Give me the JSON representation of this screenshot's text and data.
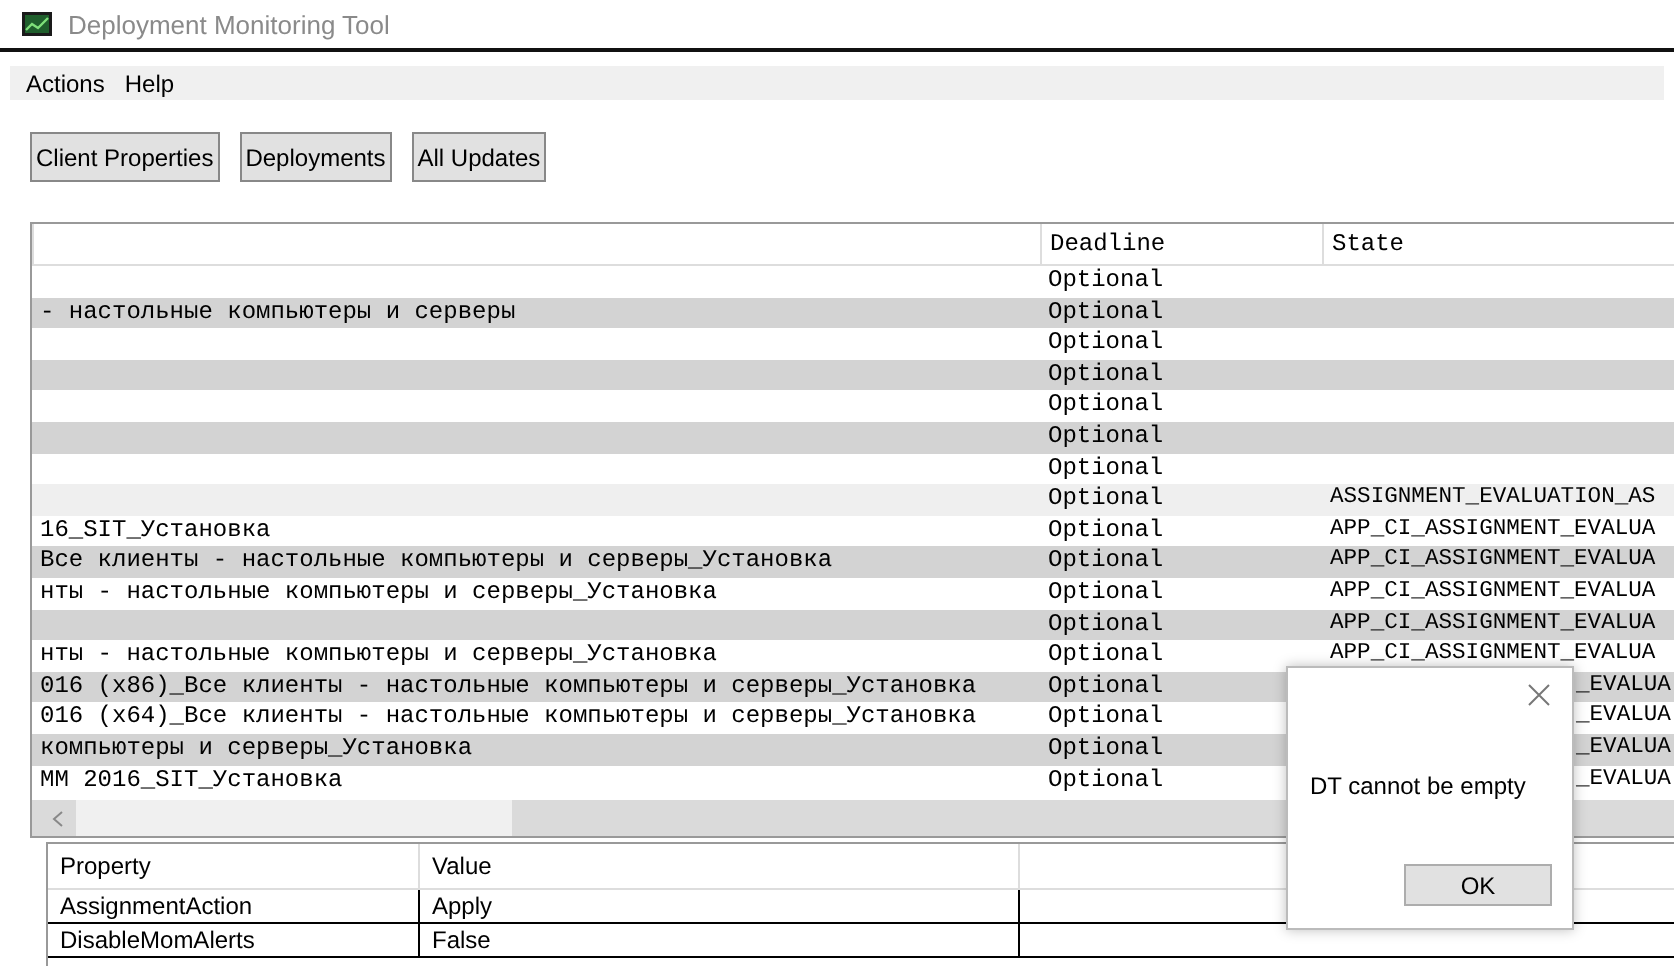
{
  "window": {
    "title": "Deployment Monitoring Tool"
  },
  "menu": [
    "Actions",
    "Help"
  ],
  "buttons": [
    "Client Properties",
    "Deployments",
    "All Updates"
  ],
  "table": {
    "columns": [
      "Deadline",
      "State"
    ],
    "rows": [
      {
        "deadline": "Optional",
        "selected": false
      },
      {
        "name": "- настольные компьютеры и серверы",
        "deadline": "Optional",
        "selected": false
      },
      {
        "deadline": "Optional",
        "selected": false
      },
      {
        "deadline": "Optional",
        "selected": false
      },
      {
        "deadline": "Optional",
        "selected": false
      },
      {
        "deadline": "Optional",
        "selected": false
      },
      {
        "deadline": "Optional",
        "selected": false
      },
      {
        "deadline": "Optional",
        "state": "ASSIGNMENT_EVALUATION_AS",
        "selected": true
      },
      {
        "name": "16_SIT_Установка",
        "deadline": "Optional",
        "state": "APP_CI_ASSIGNMENT_EVALUA",
        "selected": false
      },
      {
        "name": "Все клиенты - настольные компьютеры и серверы_Установка",
        "deadline": "Optional",
        "state": "APP_CI_ASSIGNMENT_EVALUA",
        "selected": false
      },
      {
        "name": "нты - настольные компьютеры и серверы_Установка",
        "deadline": "Optional",
        "state": "APP_CI_ASSIGNMENT_EVALUA",
        "selected": false
      },
      {
        "deadline": "Optional",
        "state": "APP_CI_ASSIGNMENT_EVALUA",
        "selected": false
      },
      {
        "name": "нты - настольные компьютеры и серверы_Установка",
        "deadline": "Optional",
        "state": "APP_CI_ASSIGNMENT_EVALUA",
        "selected": false
      },
      {
        "name": "016 (x86)_Все клиенты - настольные компьютеры и серверы_Установка",
        "deadline": "Optional",
        "state_after_dialog": "_EVALUA",
        "selected": false
      },
      {
        "name": "016 (x64)_Все клиенты - настольные компьютеры и серверы_Установка",
        "deadline": "Optional",
        "state_after_dialog": "_EVALUA",
        "selected": false
      },
      {
        "name": "компьютеры и серверы_Установка",
        "deadline": "Optional",
        "state_after_dialog": "_EVALUA",
        "selected": false
      },
      {
        "name": "MM 2016_SIT_Установка",
        "deadline": "Optional",
        "state_after_dialog": "_EVALUA",
        "selected": false
      }
    ]
  },
  "properties": {
    "columns": [
      "Property",
      "Value"
    ],
    "rows": [
      {
        "property": "AssignmentAction",
        "value": "Apply"
      },
      {
        "property": "DisableMomAlerts",
        "value": "False"
      }
    ]
  },
  "dialog": {
    "message": "DT cannot be empty",
    "button": "OK"
  }
}
